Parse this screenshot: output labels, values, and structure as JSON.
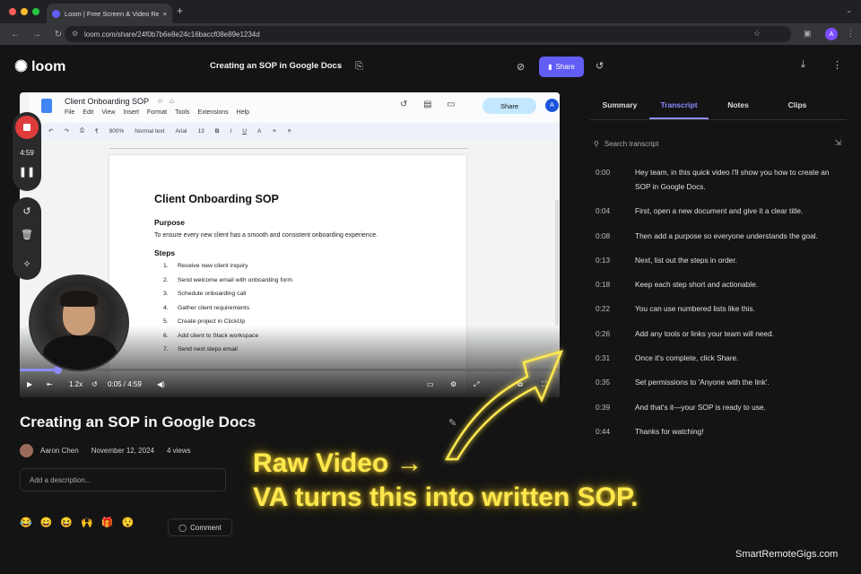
{
  "browser": {
    "tab_title": "Loom | Free Screen & Video Re",
    "url": "loom.com/share/24f0b7b6e8e24c16baccf08e89e1234d",
    "profile_initial": "A"
  },
  "loom": {
    "logo_text": "loom",
    "video_title_header": "Creating an SOP in Google Docs",
    "share_label": "Share"
  },
  "doc": {
    "name": "Client Onboarding SOP",
    "menu": [
      "File",
      "Edit",
      "View",
      "Insert",
      "Format",
      "Tools",
      "Extensions",
      "Help"
    ],
    "share_label": "Share",
    "avatar_initial": "A",
    "zoom": "900%",
    "style": "Normal text",
    "font": "Arial",
    "font_size": "13",
    "heading": "Client Onboarding SOP",
    "purpose_heading": "Purpose",
    "purpose_text": "To ensure every new client has a smooth and consistent onboarding experience.",
    "steps_heading": "Steps",
    "steps": [
      {
        "n": "1.",
        "t": "Receive new client inquiry"
      },
      {
        "n": "2.",
        "t": "Send welcome email with onboarding form"
      },
      {
        "n": "3.",
        "t": "Schedule onboarding call"
      },
      {
        "n": "4.",
        "t": "Gather client requirements"
      },
      {
        "n": "5.",
        "t": "Create project in ClickUp"
      },
      {
        "n": "6.",
        "t": "Add client to Slack workspace"
      },
      {
        "n": "7.",
        "t": "Send next steps email"
      }
    ]
  },
  "player": {
    "speed": "1.2x",
    "time": "0:05 / 4:59",
    "progress": 0.07
  },
  "recorder": {
    "time": "4:59"
  },
  "video_info": {
    "title": "Creating an SOP in Google Docs",
    "owner": "Aaron Chen",
    "date": "November 12, 2024",
    "views": "4 views",
    "description_placeholder": "Add a description...",
    "comment_label": "Comment",
    "reactions": [
      "😂",
      "😄",
      "😆",
      "🙌",
      "🎁",
      "😯"
    ]
  },
  "panel": {
    "tabs": [
      "Summary",
      "Transcript",
      "Notes",
      "Clips"
    ],
    "active_tab": "Transcript",
    "search_placeholder": "Search transcript",
    "transcript": [
      {
        "ts": "0:00",
        "text": "Hey team, in this quick video I'll show you how to create an SOP in Google Docs."
      },
      {
        "ts": "0:04",
        "text": "First, open a new document and give it a clear title."
      },
      {
        "ts": "0:08",
        "text": "Then add a purpose so everyone understands the goal."
      },
      {
        "ts": "0:13",
        "text": "Next, list out the steps in order."
      },
      {
        "ts": "0:18",
        "text": "Keep each step short and actionable."
      },
      {
        "ts": "0:22",
        "text": "You can use numbered lists like this."
      },
      {
        "ts": "0:26",
        "text": "Add any tools or links your team will need."
      },
      {
        "ts": "0:31",
        "text": "Once it's complete, click Share."
      },
      {
        "ts": "0:35",
        "text": "Set permissions to 'Anyone with the link'."
      },
      {
        "ts": "0:39",
        "text": "And that's it—your SOP is ready to use."
      },
      {
        "ts": "0:44",
        "text": "Thanks for watching!"
      }
    ]
  },
  "overlay": {
    "line1": "Raw Video →",
    "line2": "VA turns this into written SOP.",
    "brand": "SmartRemoteGigs.com",
    "accent": "#ffe84d"
  },
  "colors": {
    "accent": "#625df5",
    "transcript_active": "#8b8cff",
    "record": "#e03c3c"
  }
}
